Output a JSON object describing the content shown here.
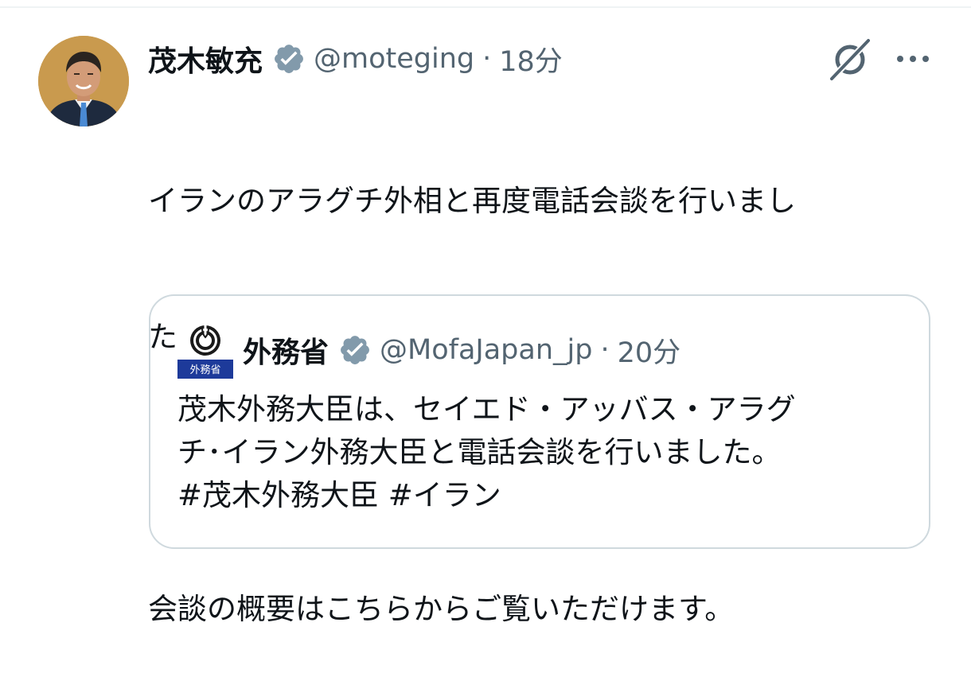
{
  "tweet": {
    "author_name": "茂木敏充",
    "handle": "@moteging",
    "separator": "·",
    "time": "18分",
    "text_lines": [
      "イランのアラグチ外相と再度電話会談を行いまし",
      "た。",
      "",
      "会談の概要はこちらからご覧いただけます。"
    ]
  },
  "quoted_tweet": {
    "author_name": "外務省",
    "avatar_label": "外務省",
    "handle": "@MofaJapan_jp",
    "separator": "·",
    "time": "20分",
    "text_lines": [
      "茂木外務大臣は、セイエド・アッバス・アラグ",
      "チ･イラン外務大臣と電話会談を行いました。",
      "#茂木外務大臣 #イラン"
    ]
  },
  "icons": {
    "verified": "verified-badge-icon",
    "grok": "grok-icon",
    "more": "more-options-icon"
  },
  "colors": {
    "text_primary": "#0f1419",
    "text_secondary": "#536471",
    "verified_badge": "#829aab",
    "card_border": "#cfd9de",
    "mofa_label_bg": "#1d3a9a"
  }
}
